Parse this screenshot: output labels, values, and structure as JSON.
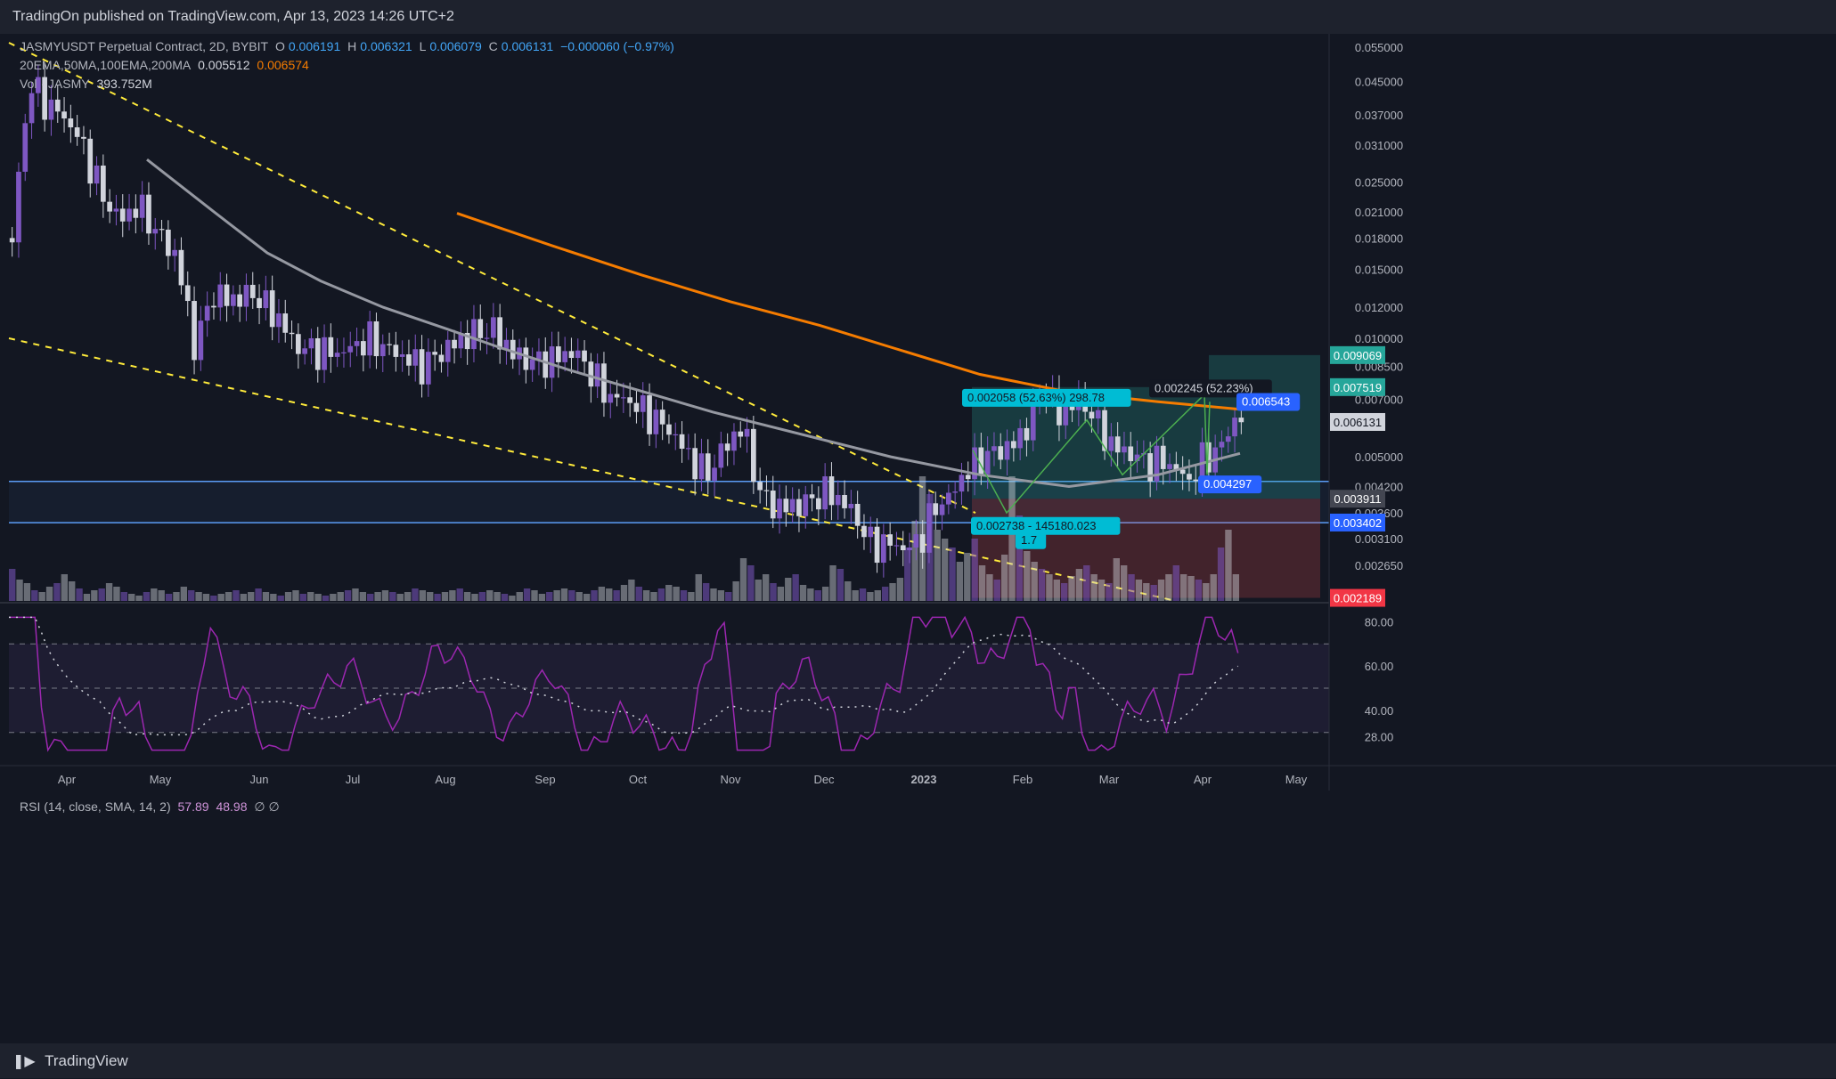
{
  "header": {
    "publisher_text": "TradingOn published on TradingView.com, Apr 13, 2023 14:26 UTC+2"
  },
  "footer": {
    "brand": "TradingView",
    "logo": "tradingview-logo-icon"
  },
  "legend": {
    "symbol": "JASMYUSDT Perpetual Contract, 2D, BYBIT",
    "open_label": "O",
    "open": "0.006191",
    "high_label": "H",
    "high": "0.006321",
    "low_label": "L",
    "low": "0.006079",
    "close_label": "C",
    "close": "0.006131",
    "change": "−0.000060 (−0.97%)",
    "ma_label": "20EMA,50MA,100EMA,200MA",
    "ma_val1": "0.005512",
    "ma_val2": "0.006574",
    "vol_label": "Vol · JASMY",
    "vol_value": "393.752M",
    "rsi_label": "RSI (14, close, SMA, 14, 2)",
    "rsi_value": "57.89",
    "rsi_sma": "48.98",
    "rsi_extra": "∅ ∅"
  },
  "colors": {
    "background": "#131722",
    "up_candle": "#7e57c2",
    "down_candle": "#d1d4dc",
    "ma_gray": "#9598a1",
    "ma_orange": "#f57c00",
    "trend_yellow": "#ffeb3b",
    "support_blue": "#5b9cf6",
    "rsi_purple": "#9c27b0",
    "long_green": "#26a69a",
    "long_red": "#ef5350"
  },
  "chart_data": [
    {
      "type": "candlestick",
      "title": "JASMYUSDT Perpetual Contract, 2D, BYBIT",
      "x_ticks": [
        "Apr",
        "May",
        "Jun",
        "Jul",
        "Aug",
        "Sep",
        "Oct",
        "Nov",
        "Dec",
        "2023",
        "Feb",
        "Mar",
        "Apr",
        "May"
      ],
      "y_scale": "log",
      "ylim": [
        0.00215,
        0.0595
      ],
      "y_ticks": [
        "0.055000",
        "0.045000",
        "0.037000",
        "0.031000",
        "0.025000",
        "0.021000",
        "0.018000",
        "0.015000",
        "0.012000",
        "0.010000",
        "0.008500",
        "0.007000",
        "0.005000",
        "0.004200",
        "0.003600",
        "0.003100",
        "0.002650"
      ],
      "price_tags": [
        {
          "label": "0.009069",
          "color": "#26a69a",
          "value": 0.009069
        },
        {
          "label": "0.007519",
          "color": "#26a69a",
          "value": 0.007519
        },
        {
          "label": "0.006131",
          "color": "#d1d4dc",
          "value": 0.006131
        },
        {
          "label": "0.003911",
          "color": "#434651",
          "value": 0.003911
        },
        {
          "label": "0.003402",
          "color": "#2962ff",
          "value": 0.003402
        },
        {
          "label": "0.002189",
          "color": "#f23645",
          "value": 0.002189
        }
      ],
      "series": [
        {
          "name": "Price",
          "values": "OHLC candles, ~195 bars from Mar 2022 to Apr 13 2023, from ~0.045 peak down to ~0.0029 low (late Dec 2022), rally to ~0.0082 (Feb 2023), close 0.006131"
        },
        {
          "name": "50MA",
          "values": [
            [
              0.0285,
              0.021,
              0.0165,
              0.014,
              0.012,
              0.0106,
              0.0095,
              0.0083,
              0.0065,
              0.005,
              0.0045,
              0.0042,
              0.0045,
              0.0051
            ]
          ]
        },
        {
          "name": "200MA",
          "values": [
            [
              0.0208,
              0.0172,
              0.0145,
              0.0124,
              0.0108,
              0.0095,
              0.0081,
              0.0073,
              0.0069,
              0.0066
            ]
          ]
        }
      ],
      "horizontal_levels": [
        0.00433,
        0.0034
      ],
      "annotations": [
        {
          "text": "0.002058 (52.63%) 298.78",
          "value": 0.00706
        },
        {
          "text": "0.002245 (52.23%)",
          "value": 0.00708
        },
        {
          "text": "0.006543",
          "value": 0.006543
        },
        {
          "text": "0.004297",
          "value": 0.004297
        },
        {
          "text": "0.002738 - 145180.023",
          "value": 0.0033
        },
        {
          "text": "1.7",
          "value": 0.0031
        }
      ],
      "volume_label": "Vol · JASMY 393.752M"
    },
    {
      "type": "line",
      "title": "RSI (14, close, SMA, 14, 2)",
      "ylim": [
        15,
        87
      ],
      "y_ticks": [
        "80.00",
        "60.00",
        "40.00",
        "28.00"
      ],
      "bands": [
        70,
        30,
        50
      ],
      "last_values": {
        "RSI": 57.89,
        "SMA": 48.98
      }
    }
  ]
}
